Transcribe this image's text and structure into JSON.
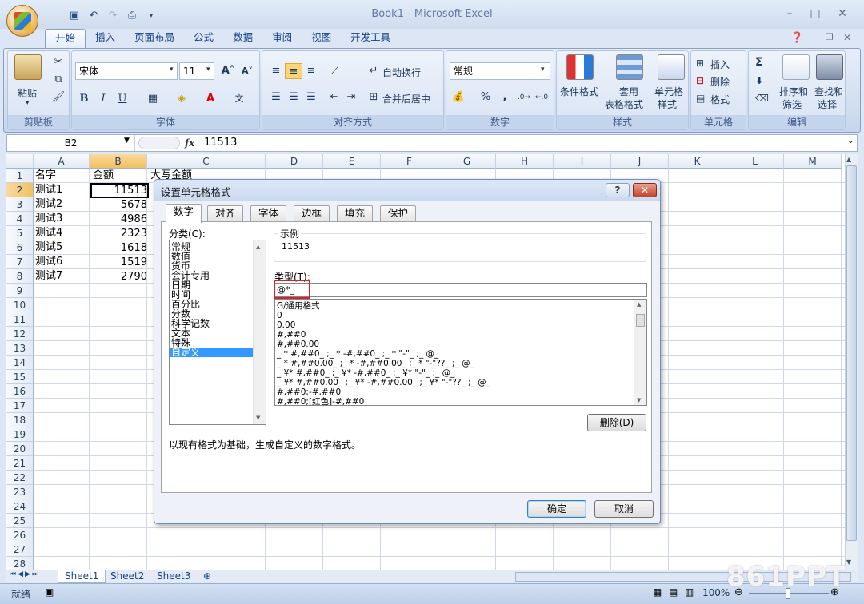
{
  "window": {
    "title": "Book1 - Microsoft Excel",
    "minimize": "–",
    "maximize": "□",
    "close": "✕"
  },
  "ribbon_tabs": [
    "开始",
    "插入",
    "页面布局",
    "公式",
    "数据",
    "审阅",
    "视图",
    "开发工具"
  ],
  "ribbon": {
    "clipboard": {
      "label": "剪贴板",
      "paste": "粘贴"
    },
    "font": {
      "label": "字体",
      "name": "宋体",
      "size": "11"
    },
    "alignment": {
      "label": "对齐方式",
      "wrap": "自动换行",
      "merge": "合并后居中"
    },
    "number": {
      "label": "数字",
      "format": "常规",
      "percent": "%",
      "comma": ","
    },
    "styles": {
      "label": "样式",
      "conditional": "条件格式",
      "as_table_1": "套用",
      "as_table_2": "表格格式",
      "cell_style_1": "单元格",
      "cell_style_2": "样式"
    },
    "cells": {
      "label": "单元格",
      "insert": "插入",
      "delete": "删除",
      "format": "格式"
    },
    "editing": {
      "label": "编辑",
      "sort_1": "排序和",
      "sort_2": "筛选",
      "find_1": "查找和",
      "find_2": "选择",
      "sigma": "Σ"
    }
  },
  "formula_bar": {
    "name_box": "B2",
    "fx": "fx",
    "value": "11513"
  },
  "columns": [
    "A",
    "B",
    "C",
    "D",
    "E",
    "F",
    "G",
    "H",
    "I",
    "J",
    "K",
    "L",
    "M"
  ],
  "rows": [
    "1",
    "2",
    "3",
    "4",
    "5",
    "6",
    "7",
    "8",
    "9",
    "10",
    "11",
    "12",
    "13",
    "14",
    "15",
    "16",
    "17",
    "18",
    "19",
    "20",
    "21",
    "22",
    "23",
    "24",
    "25",
    "26",
    "27",
    "28"
  ],
  "cells": {
    "header": {
      "a": "名字",
      "b": "金额",
      "c": "大写金额"
    },
    "data": [
      {
        "name": "测试1",
        "amount": "11513"
      },
      {
        "name": "测试2",
        "amount": "5678"
      },
      {
        "name": "测试3",
        "amount": "4986"
      },
      {
        "name": "测试4",
        "amount": "2323"
      },
      {
        "name": "测试5",
        "amount": "1618"
      },
      {
        "name": "测试6",
        "amount": "1519"
      },
      {
        "name": "测试7",
        "amount": "2790"
      }
    ]
  },
  "sheets": [
    "Sheet1",
    "Sheet2",
    "Sheet3"
  ],
  "status": {
    "ready": "就绪",
    "zoom": "100%"
  },
  "dialog": {
    "title": "设置单元格格式",
    "help": "?",
    "close": "✕",
    "tabs": [
      "数字",
      "对齐",
      "字体",
      "边框",
      "填充",
      "保护"
    ],
    "category_label": "分类(C):",
    "categories": [
      "常规",
      "数值",
      "货币",
      "会计专用",
      "日期",
      "时间",
      "百分比",
      "分数",
      "科学记数",
      "文本",
      "特殊",
      "自定义"
    ],
    "selected_category": "自定义",
    "sample_label": "示例",
    "sample_value": "11513",
    "type_label": "类型(T):",
    "type_value": "@*_",
    "formats": [
      "G/通用格式",
      "0",
      "0.00",
      "#,##0",
      "#,##0.00",
      "_ * #,##0_ ;_ * -#,##0_ ;_ * \"-\"_ ;_ @_",
      "_ * #,##0.00_ ;_ * -#,##0.00_ ;_ * \"-\"??_ ;_ @_",
      "_ ¥* #,##0_ ;_ ¥* -#,##0_ ;_ ¥* \"-\"_ ;_ @_",
      "_ ¥* #,##0.00_ ;_ ¥* -#,##0.00_ ;_ ¥* \"-\"??_ ;_ @_",
      "#,##0;-#,##0",
      "#,##0;[红色]-#,##0"
    ],
    "delete_button": "删除(D)",
    "description": "以现有格式为基础，生成自定义的数字格式。",
    "ok": "确定",
    "cancel": "取消"
  },
  "watermark": "861PPT"
}
